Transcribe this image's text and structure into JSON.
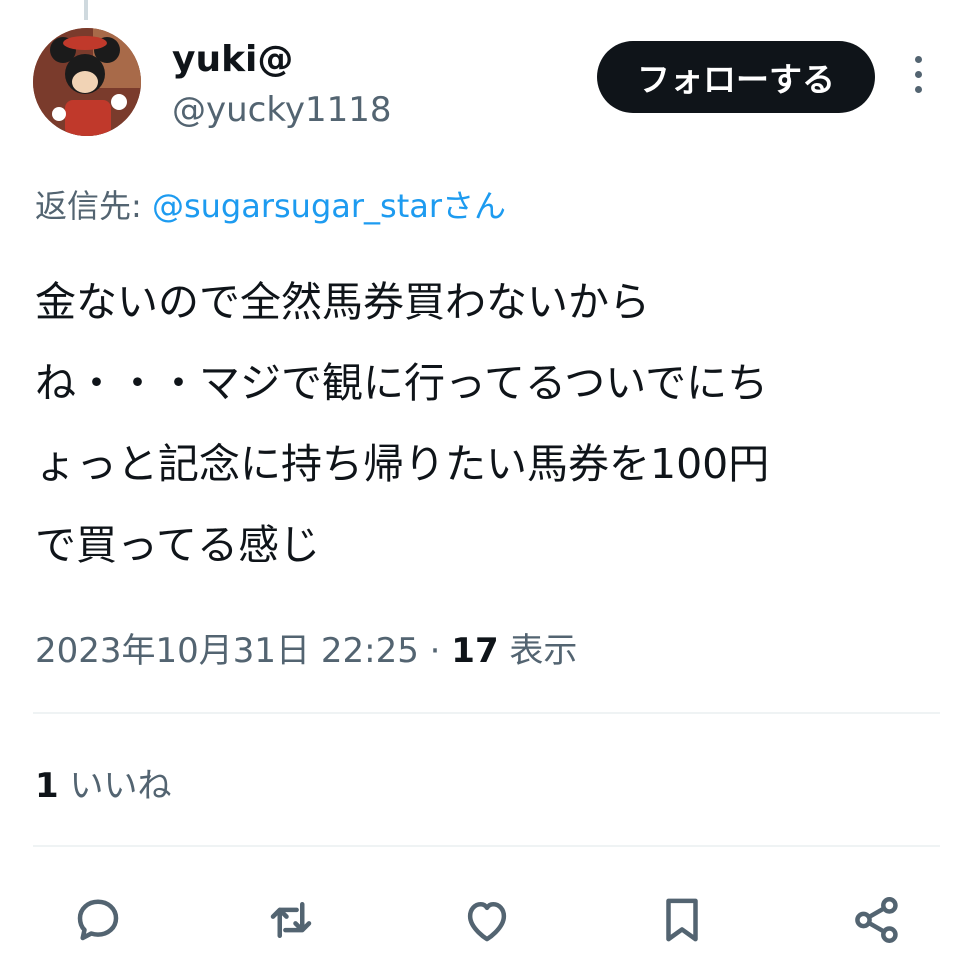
{
  "user": {
    "display_name": "yuki@",
    "handle": "@yucky1118",
    "avatar": "avatar-character-photo"
  },
  "follow_button": {
    "label": "フォローする"
  },
  "more_menu": {
    "icon": "more-vertical-icon"
  },
  "reply_to": {
    "prefix": "返信先: ",
    "mention": "@sugarsugar_star",
    "suffix": "さん"
  },
  "tweet": {
    "lines": [
      "金ないので全然馬券買わないから",
      "ね・・・マジで観に行ってるついでにち",
      "ょっと記念に持ち帰りたい馬券を100円",
      "で買ってる感じ"
    ]
  },
  "meta": {
    "datetime": "2023年10月31日 22:25",
    "separator": " · ",
    "views_count": "17",
    "views_label": " 表示"
  },
  "likes": {
    "count": "1",
    "label": " いいね"
  },
  "actions": [
    {
      "name": "reply",
      "icon": "reply-icon"
    },
    {
      "name": "retweet",
      "icon": "retweet-icon"
    },
    {
      "name": "like",
      "icon": "heart-icon"
    },
    {
      "name": "bookmark",
      "icon": "bookmark-icon"
    },
    {
      "name": "share",
      "icon": "share-icon"
    }
  ],
  "colors": {
    "text": "#0f1419",
    "secondary": "#536471",
    "link": "#1d9bf0",
    "divider": "#eff3f4",
    "button_bg": "#0f1419"
  }
}
